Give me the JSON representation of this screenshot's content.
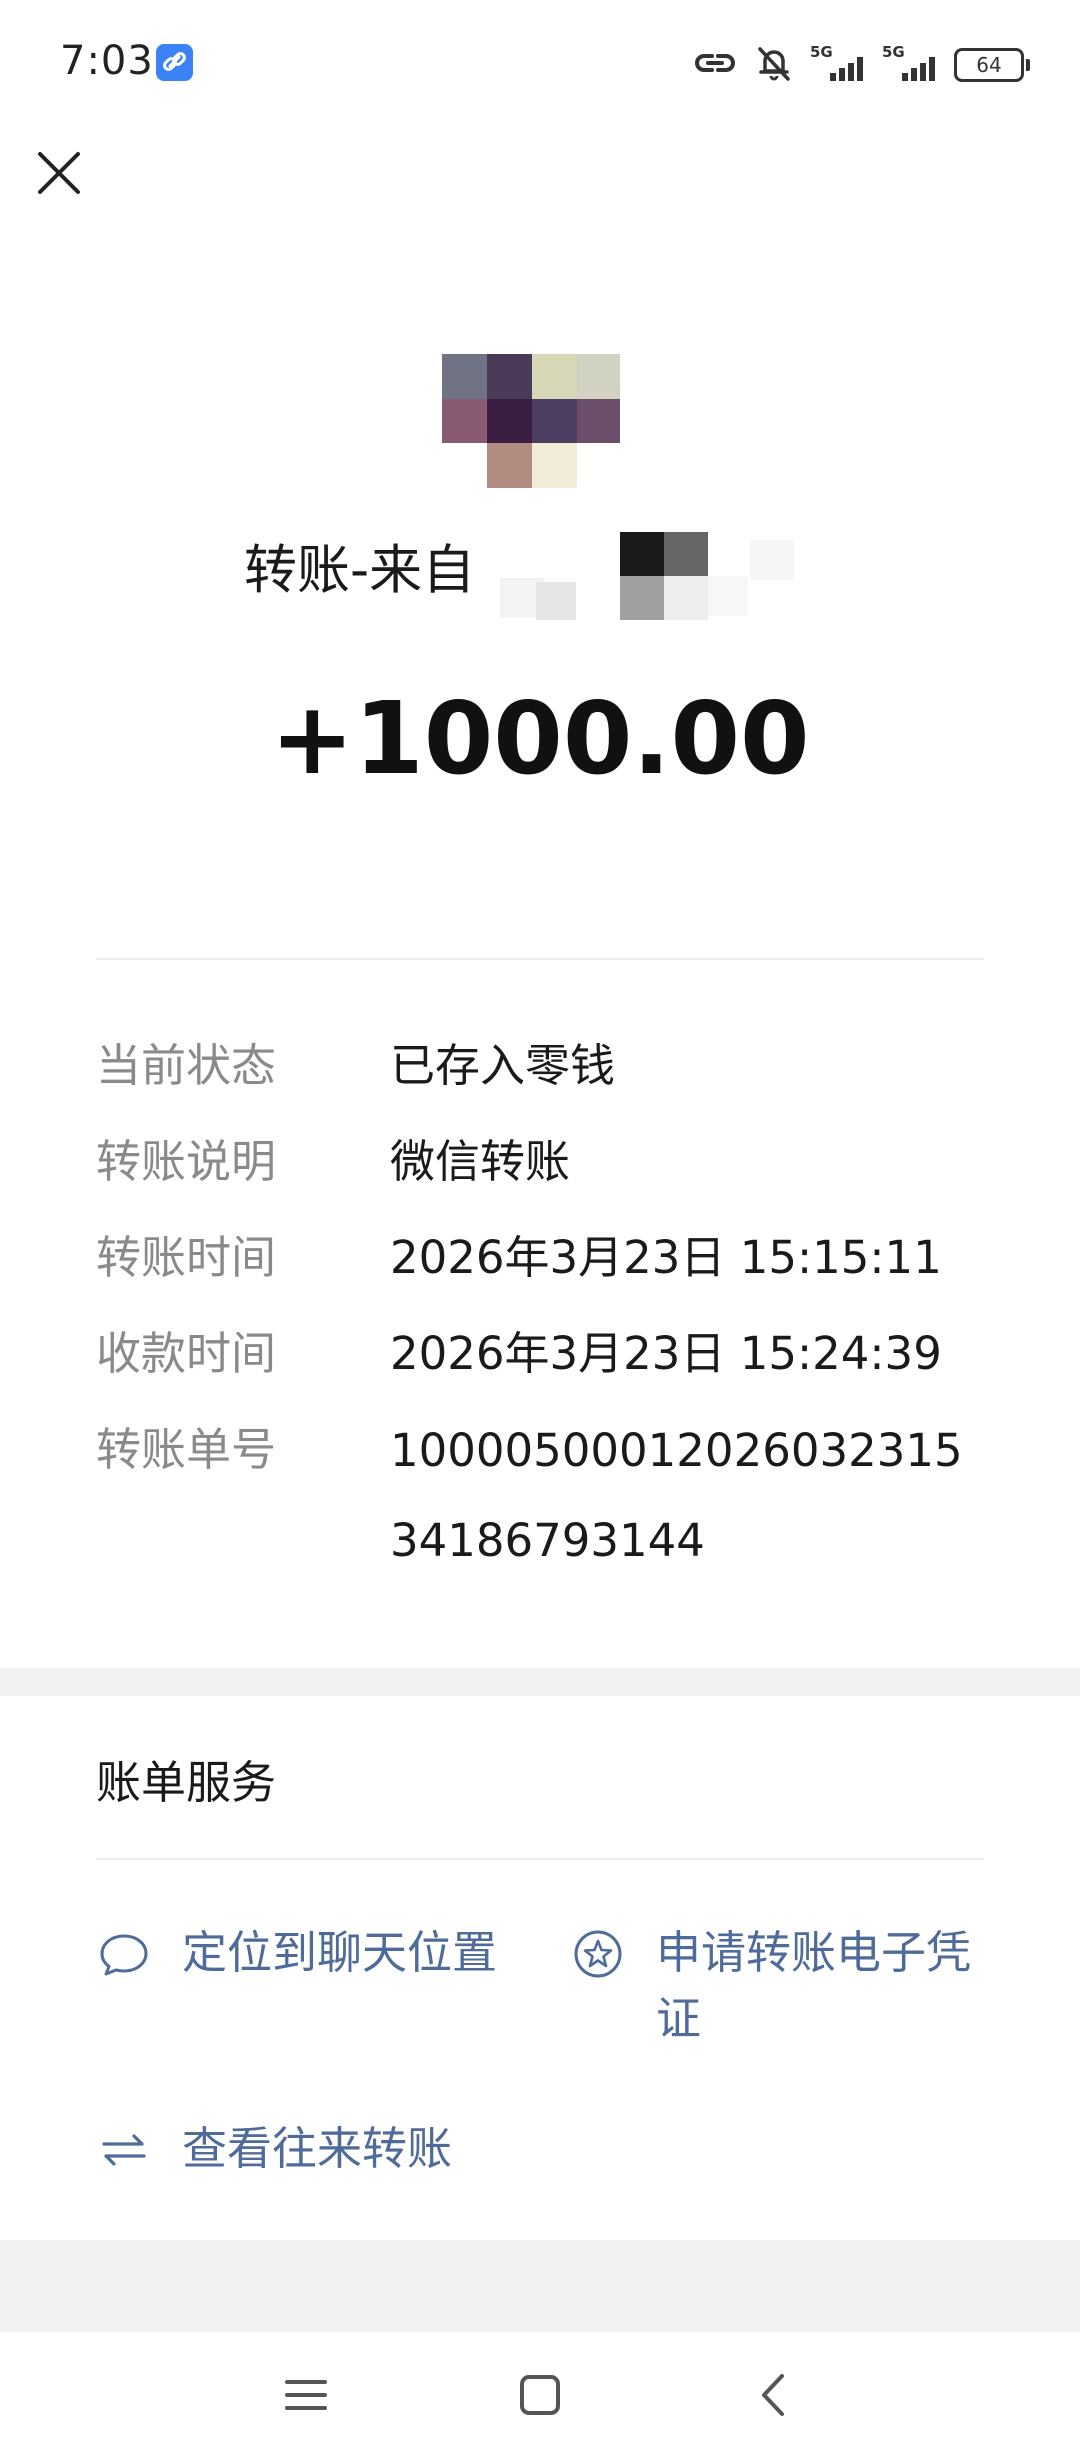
{
  "status_bar": {
    "time": "7:03",
    "network_1": "5G",
    "network_2": "5G",
    "battery": "64",
    "icons": [
      "link-app-icon",
      "link-icon",
      "mute-icon",
      "signal-icon",
      "signal-icon",
      "battery-icon"
    ]
  },
  "header": {
    "close_icon": "close-icon",
    "title": "转账-来自",
    "amount": "+1000.00"
  },
  "details": {
    "rows": [
      {
        "label": "当前状态",
        "value": "已存入零钱"
      },
      {
        "label": "转账说明",
        "value": "微信转账"
      },
      {
        "label": "转账时间",
        "value": "2026年3月23日 15:15:11"
      },
      {
        "label": "收款时间",
        "value": "2026年3月23日 15:24:39"
      },
      {
        "label": "转账单号",
        "value": "1000050001202603231534186793144"
      }
    ]
  },
  "services": {
    "title": "账单服务",
    "items": [
      {
        "label": "定位到聊天位置",
        "icon": "chat-bubble-icon"
      },
      {
        "label": "申请转账电子凭证",
        "icon": "star-badge-icon"
      },
      {
        "label": "查看往来转账",
        "icon": "swap-arrows-icon"
      }
    ]
  },
  "nav": {
    "icons": [
      "menu-icon",
      "home-icon",
      "back-icon"
    ]
  },
  "colors": {
    "accent_link": "#4e6b99",
    "label_gray": "#8a8a8a",
    "text": "#1a1a1a",
    "badge_blue": "#3b82f6"
  }
}
